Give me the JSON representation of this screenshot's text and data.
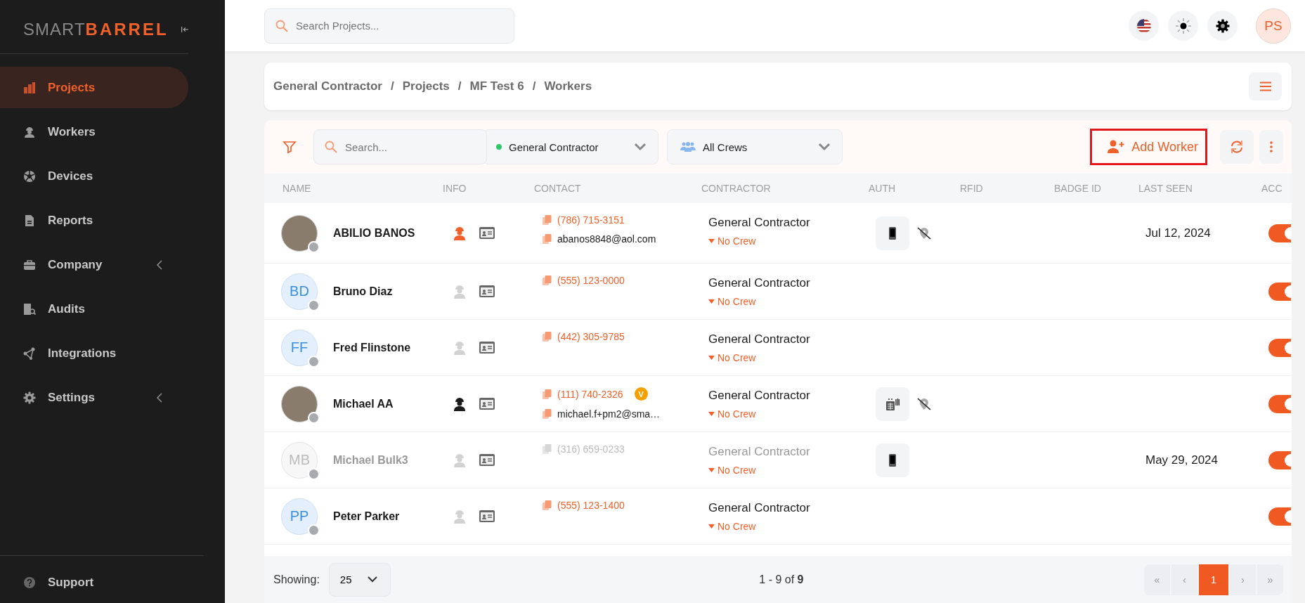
{
  "sidebar": {
    "logo": {
      "light": "SMART",
      "bold": "BARREL"
    },
    "items": [
      {
        "label": "Projects",
        "kind": "projects",
        "selected": true,
        "submenu": false
      },
      {
        "label": "Workers",
        "kind": "workers",
        "selected": false,
        "submenu": false
      },
      {
        "label": "Devices",
        "kind": "devices",
        "selected": false,
        "submenu": false
      },
      {
        "label": "Reports",
        "kind": "reports",
        "selected": false,
        "submenu": false
      },
      {
        "label": "Company",
        "kind": "company",
        "selected": false,
        "submenu": true
      },
      {
        "label": "Audits",
        "kind": "audits",
        "selected": false,
        "submenu": false
      },
      {
        "label": "Integrations",
        "kind": "integrations",
        "selected": false,
        "submenu": false
      },
      {
        "label": "Settings",
        "kind": "settings",
        "selected": false,
        "submenu": true
      }
    ],
    "support": {
      "label": "Support"
    }
  },
  "topbar": {
    "search": {
      "placeholder": "Search Projects..."
    },
    "user_initials": "PS"
  },
  "breadcrumb": [
    {
      "kind": "link",
      "label": "General Contractor"
    },
    {
      "kind": "separator",
      "label": "/"
    },
    {
      "kind": "link",
      "label": "Projects"
    },
    {
      "kind": "separator",
      "label": "/"
    },
    {
      "kind": "link",
      "label": "MF Test 6"
    },
    {
      "kind": "separator",
      "label": "/"
    },
    {
      "kind": "current",
      "label": "Workers"
    }
  ],
  "toolbar": {
    "search": {
      "placeholder": "Search..."
    },
    "contractor_filter": "General Contractor",
    "crew_filter": "All Crews",
    "add_button": "Add Worker"
  },
  "table": {
    "columns": [
      "NAME",
      "INFO",
      "CONTACT",
      "CONTRACTOR",
      "AUTH",
      "RFID",
      "BADGE ID",
      "LAST SEEN",
      "ACC"
    ],
    "rows": [
      {
        "avatar": {
          "kind": "photo"
        },
        "name": "ABILIO BANOS",
        "disabled": false,
        "role_icon": {
          "kind": "highlighted"
        },
        "phone": "(786) 715-3151",
        "phone_verified": false,
        "email": "abanos8848@aol.com",
        "contractor": "General Contractor",
        "crew": "No Crew",
        "auth": [
          {
            "kind": "phone"
          },
          {
            "kind": "location-off"
          }
        ],
        "last_seen": "Jul 12, 2024",
        "on": true
      },
      {
        "avatar": {
          "kind": "initials",
          "text": "BD"
        },
        "name": "Bruno Diaz",
        "disabled": false,
        "role_icon": {
          "kind": "muted"
        },
        "phone": "(555) 123-0000",
        "phone_verified": false,
        "contractor": "General Contractor",
        "crew": "No Crew",
        "auth": [],
        "on": true
      },
      {
        "avatar": {
          "kind": "initials",
          "text": "FF"
        },
        "name": "Fred Flinstone",
        "disabled": false,
        "role_icon": {
          "kind": "muted"
        },
        "phone": "(442) 305-9785",
        "phone_verified": false,
        "contractor": "General Contractor",
        "crew": "No Crew",
        "auth": [],
        "on": true
      },
      {
        "avatar": {
          "kind": "photo"
        },
        "name": "Michael AA",
        "disabled": false,
        "role_icon": {
          "kind": "dark"
        },
        "phone": "(111) 740-2326",
        "phone_verified": true,
        "verified_badge": "V",
        "email": "michael.f+pm2@sma…",
        "contractor": "General Contractor",
        "crew": "No Crew",
        "auth": [
          {
            "kind": "keypad"
          },
          {
            "kind": "location-off"
          }
        ],
        "on": true
      },
      {
        "avatar": {
          "kind": "initials",
          "text": "MB"
        },
        "name": "Michael Bulk3",
        "disabled": true,
        "role_icon": {
          "kind": "muted"
        },
        "phone": "(316) 659-0233",
        "phone_verified": false,
        "contractor": "General Contractor",
        "crew": "No Crew",
        "auth": [
          {
            "kind": "phone"
          }
        ],
        "last_seen": "May 29, 2024",
        "on": true
      },
      {
        "avatar": {
          "kind": "initials",
          "text": "PP"
        },
        "name": "Peter Parker",
        "disabled": false,
        "role_icon": {
          "kind": "muted"
        },
        "phone": "(555) 123-1400",
        "phone_verified": false,
        "contractor": "General Contractor",
        "crew": "No Crew",
        "auth": [],
        "on": true
      }
    ]
  },
  "footer": {
    "showing_label": "Showing:",
    "page_size": "25",
    "range": "1 - 9 of **9**",
    "pages": [
      {
        "label": "«",
        "selected": false
      },
      {
        "label": "‹",
        "selected": false
      },
      {
        "label": "1",
        "selected": true
      },
      {
        "label": "›",
        "selected": false
      },
      {
        "label": "»",
        "selected": false
      }
    ]
  }
}
